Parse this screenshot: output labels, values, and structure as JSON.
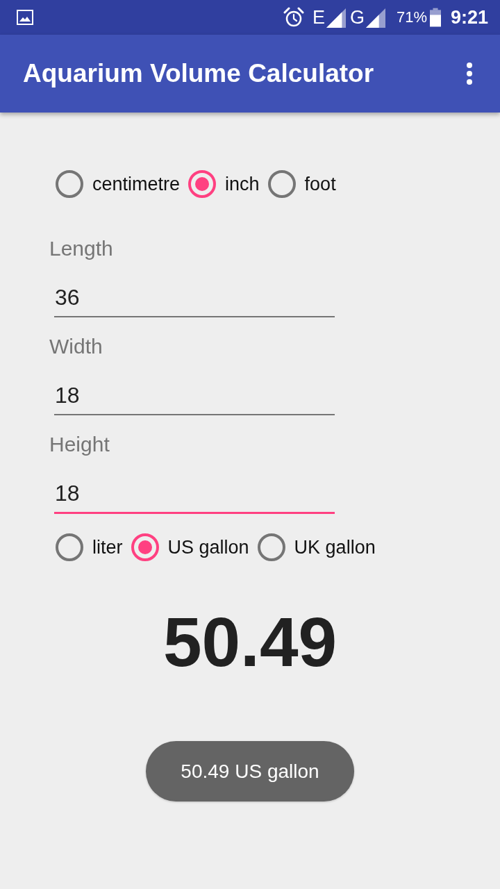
{
  "status_bar": {
    "network_1": "E",
    "network_2": "G",
    "battery": "71%",
    "time": "9:21"
  },
  "app_bar": {
    "title": "Aquarium Volume Calculator"
  },
  "units": [
    {
      "label": "centimetre",
      "selected": false
    },
    {
      "label": "inch",
      "selected": true
    },
    {
      "label": "foot",
      "selected": false
    }
  ],
  "fields": [
    {
      "label": "Length",
      "value": "36",
      "focused": false
    },
    {
      "label": "Width",
      "value": "18",
      "focused": false
    },
    {
      "label": "Height",
      "value": "18",
      "focused": true
    }
  ],
  "volume_units": [
    {
      "label": "liter",
      "selected": false
    },
    {
      "label": "US gallon",
      "selected": true
    },
    {
      "label": "UK gallon",
      "selected": false
    }
  ],
  "result": "50.49",
  "toast": "50.49 US gallon"
}
